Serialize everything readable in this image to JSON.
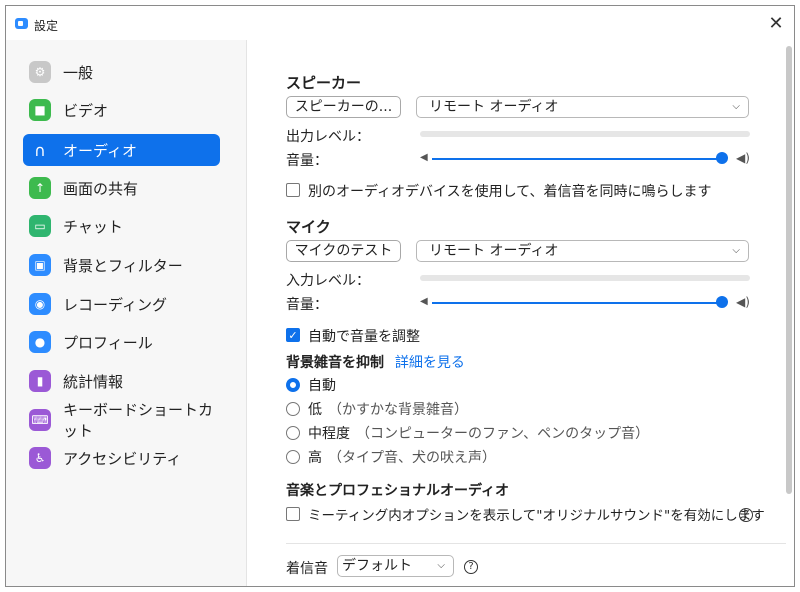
{
  "window": {
    "title": "設定"
  },
  "sidebar": {
    "items": [
      {
        "label": "一般",
        "icon": "gear-icon",
        "color": "#c8c8c8",
        "glyph": "⚙"
      },
      {
        "label": "ビデオ",
        "icon": "video-camera-icon",
        "color": "#3dba4e",
        "glyph": "■"
      },
      {
        "label": "オーディオ",
        "icon": "headphones-icon",
        "color": "#0e71eb",
        "glyph": "∩"
      },
      {
        "label": "画面の共有",
        "icon": "share-screen-icon",
        "color": "#3dba4e",
        "glyph": "↑"
      },
      {
        "label": "チャット",
        "icon": "chat-bubble-icon",
        "color": "#2fb56f",
        "glyph": "▭"
      },
      {
        "label": "背景とフィルター",
        "icon": "background-filter-icon",
        "color": "#2d8cff",
        "glyph": "▣"
      },
      {
        "label": "レコーディング",
        "icon": "recording-icon",
        "color": "#2d8cff",
        "glyph": "◉"
      },
      {
        "label": "プロフィール",
        "icon": "profile-icon",
        "color": "#2d8cff",
        "glyph": "●"
      },
      {
        "label": "統計情報",
        "icon": "statistics-icon",
        "color": "#9b59d6",
        "glyph": "▮"
      },
      {
        "label": "キーボードショートカット",
        "icon": "keyboard-icon",
        "color": "#9b59d6",
        "glyph": "⌨"
      },
      {
        "label": "アクセシビリティ",
        "icon": "accessibility-icon",
        "color": "#9b59d6",
        "glyph": "♿"
      }
    ],
    "active_index": 2
  },
  "speaker": {
    "title": "スピーカー",
    "test_button": "スピーカーの...",
    "device": "リモート オーディオ",
    "output_level_label": "出力レベル：",
    "volume_label": "音量：",
    "volume_level": 1.0
  },
  "ring_separately": {
    "label": "別のオーディオデバイスを使用して、着信音を同時に鳴らします",
    "checked": false
  },
  "mic": {
    "title": "マイク",
    "test_button": "マイクのテスト",
    "device": "リモート オーディオ",
    "input_level_label": "入力レベル：",
    "volume_label": "音量：",
    "volume_level": 1.0
  },
  "auto_adjust": {
    "label": "自動で音量を調整",
    "checked": true
  },
  "noise": {
    "title": "背景雑音を抑制",
    "link": "詳細を見る",
    "options": [
      {
        "label": "自動",
        "note": "",
        "selected": true
      },
      {
        "label": "低",
        "note": "（かすかな背景雑音）",
        "selected": false
      },
      {
        "label": "中程度",
        "note": "（コンピューターのファン、ペンのタップ音）",
        "selected": false
      },
      {
        "label": "高",
        "note": "（タイプ音、犬の吠え声）",
        "selected": false
      }
    ]
  },
  "music": {
    "title": "音楽とプロフェショナルオーディオ",
    "option_label": "ミーティング内オプションを表示して\"オリジナルサウンド\"を有効にします",
    "checked": false
  },
  "ringtone": {
    "label": "着信音",
    "value": "デフォルト"
  },
  "colors": {
    "accent": "#0e71eb"
  }
}
